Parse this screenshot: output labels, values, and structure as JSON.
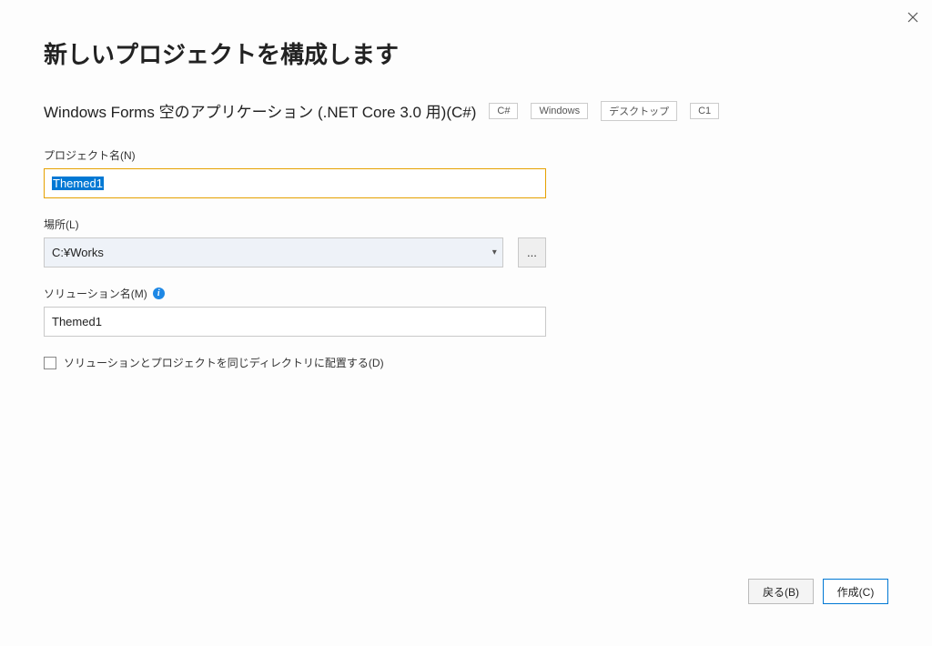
{
  "title": "新しいプロジェクトを構成します",
  "template": {
    "name": "Windows Forms 空のアプリケーション (.NET Core 3.0 用)(C#)",
    "tags": [
      "C#",
      "Windows",
      "デスクトップ",
      "C1"
    ]
  },
  "fields": {
    "projectName": {
      "label": "プロジェクト名(N)",
      "value": "Themed1"
    },
    "location": {
      "label": "場所(L)",
      "value": "C:¥Works",
      "browse": "..."
    },
    "solutionName": {
      "label": "ソリューション名(M)",
      "value": "Themed1"
    }
  },
  "checkbox": {
    "label": "ソリューションとプロジェクトを同じディレクトリに配置する(D)",
    "checked": false
  },
  "buttons": {
    "back": "戻る(B)",
    "create": "作成(C)"
  }
}
